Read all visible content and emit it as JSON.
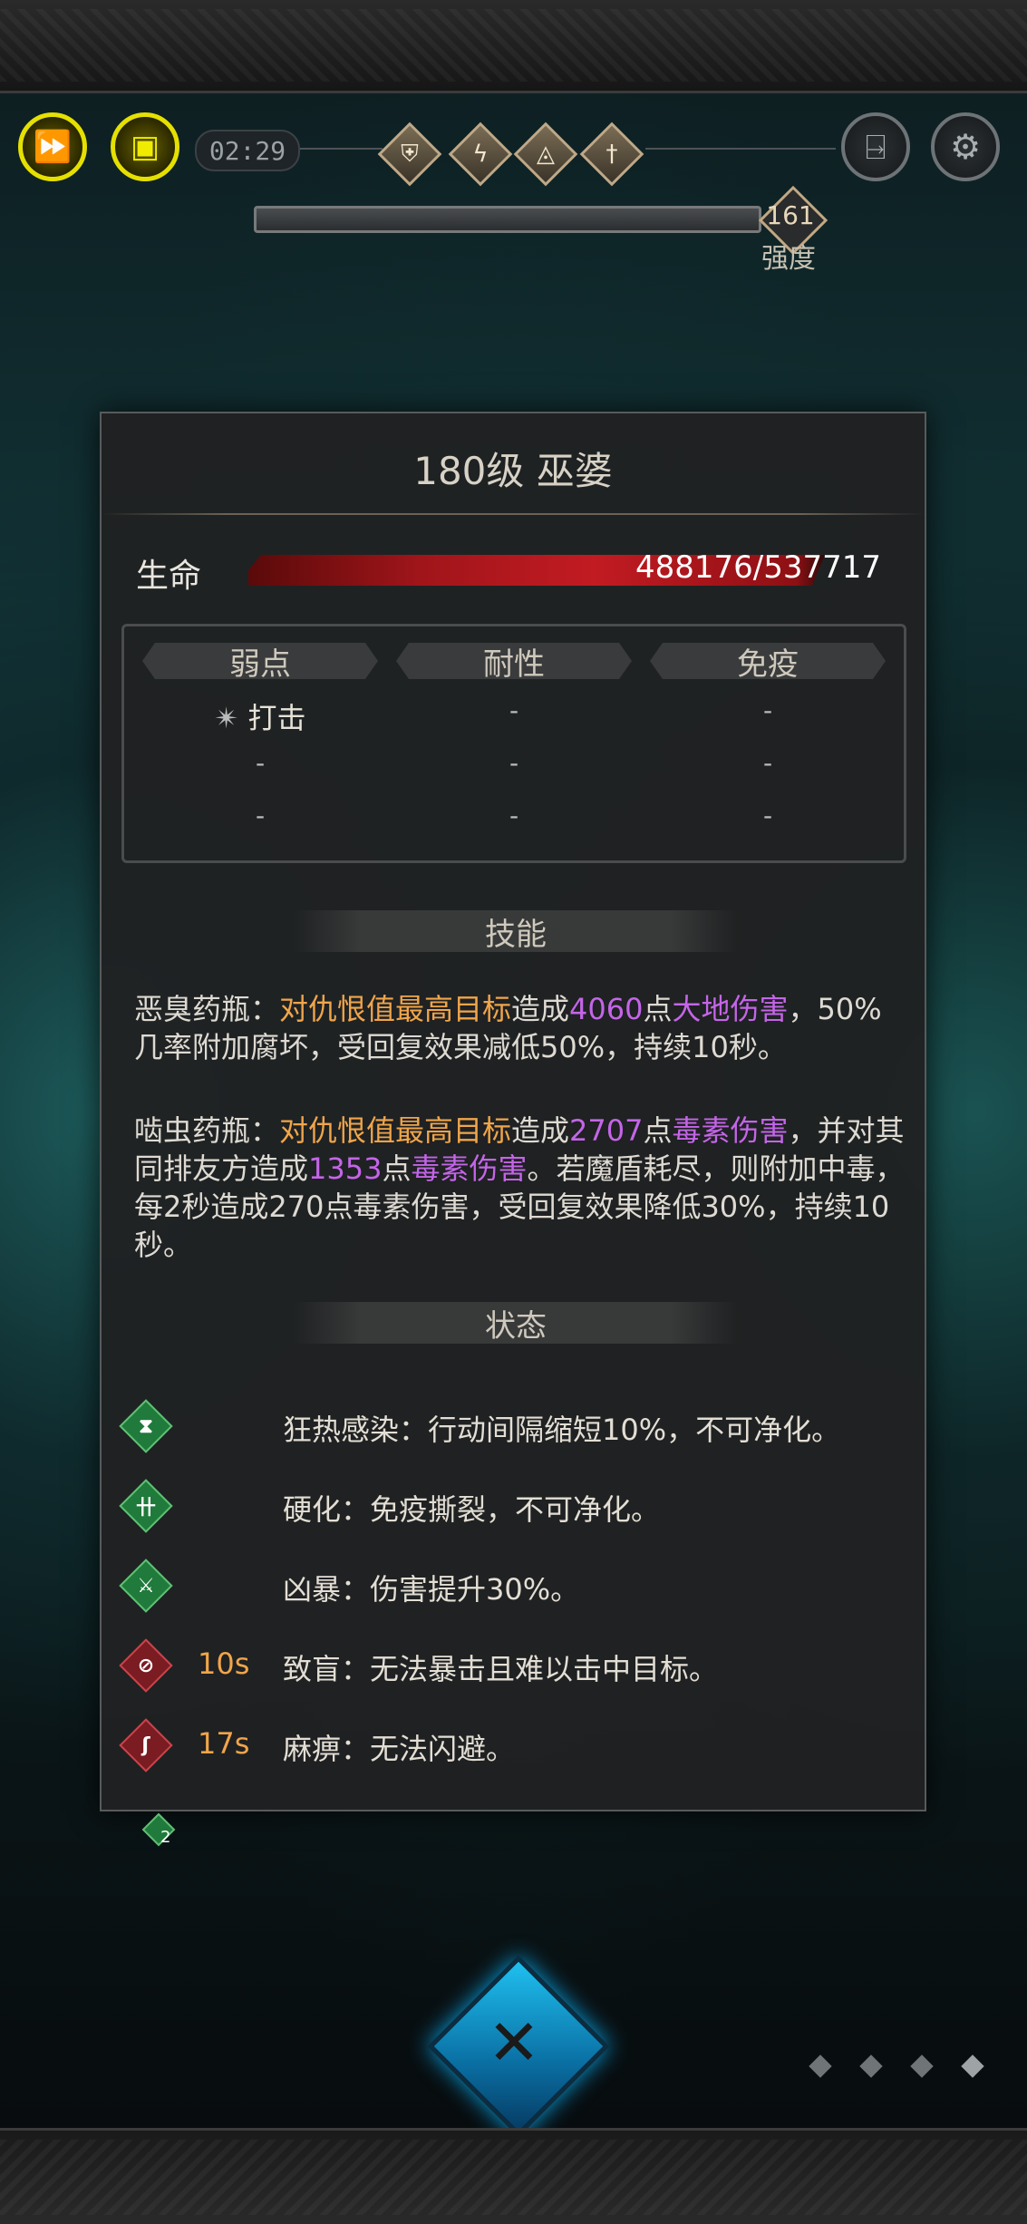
{
  "hud": {
    "timer": "02:29",
    "fast_forward_icon": "fast-forward-icon",
    "auto_icon": "auto-play-icon",
    "exit_icon": "exit-door-icon",
    "settings_icon": "gear-icon",
    "badges": [
      {
        "icon": "shield-rune-icon",
        "glyph": "⛨"
      },
      {
        "icon": "lightning-rune-icon",
        "glyph": "ϟ"
      },
      {
        "icon": "eye-triangle-rune-icon",
        "glyph": "◬"
      },
      {
        "icon": "sword-rune-icon",
        "glyph": "†"
      }
    ],
    "strength_value": "161",
    "strength_label": "强度"
  },
  "enemy": {
    "title": "180级  巫婆",
    "hp_label": "生命",
    "hp_text": "488176/537717",
    "hp_fraction": 0.908
  },
  "resistances": {
    "headers": [
      "弱点",
      "耐性",
      "免疫"
    ],
    "rows": [
      [
        "打击",
        "-",
        "-"
      ],
      [
        "-",
        "-",
        "-"
      ],
      [
        "-",
        "-",
        "-"
      ]
    ],
    "weak_icon": "claw-strike-icon"
  },
  "skills": {
    "header": "技能",
    "list": [
      {
        "name": "恶臭药瓶：",
        "target": "对仇恨值最高目标",
        "p1": "造成",
        "dmg": "4060",
        "p2": "点",
        "type": "大地伤害",
        "rest": "，50%几率附加腐坏，受回复效果减低50%，持续10秒。"
      },
      {
        "name": "啮虫药瓶：",
        "target": "对仇恨值最高目标",
        "p1": "造成",
        "dmg": "2707",
        "p2": "点",
        "type": "毒素伤害",
        "p3": "，并对其同排友方造成",
        "dmg2": "1353",
        "p4": "点",
        "type2": "毒素伤害",
        "rest": "。若魔盾耗尽，则附加中毒，每2秒造成270点毒素伤害，受回复效果降低30%，持续10秒。"
      }
    ]
  },
  "status": {
    "header": "状态",
    "list": [
      {
        "icon": "hourglass-icon",
        "glyph": "⧗",
        "color": "green",
        "duration": "",
        "text": "狂热感染：行动间隔缩短10%，不可净化。"
      },
      {
        "icon": "harden-icon",
        "glyph": "卄",
        "color": "green",
        "duration": "",
        "text": "硬化：免疫撕裂，不可净化。"
      },
      {
        "icon": "ferocity-icon",
        "glyph": "⚔",
        "color": "green",
        "duration": "",
        "text": "凶暴：伤害提升30%。"
      },
      {
        "icon": "blind-eye-icon",
        "glyph": "⊘",
        "color": "red",
        "duration": "10s",
        "text": "致盲：无法暴击且难以击中目标。"
      },
      {
        "icon": "paralysis-icon",
        "glyph": "ʃ",
        "color": "red",
        "duration": "17s",
        "text": "麻痹：无法闪避。"
      }
    ]
  },
  "small_buff_count": "2",
  "close_icon": "close-crossed-swords-icon"
}
